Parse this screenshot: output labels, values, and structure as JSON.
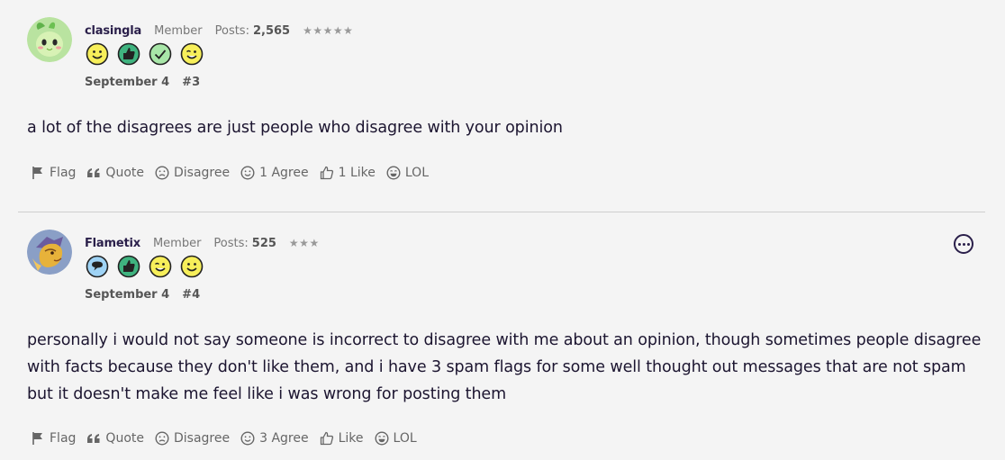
{
  "posts": [
    {
      "username": "clasingla",
      "role": "Member",
      "posts_label": "Posts:",
      "posts_count": "2,565",
      "stars": "★★★★★",
      "date": "September 4",
      "number": "#3",
      "badges": [
        "smile-icon",
        "thumbs-up-icon",
        "checkmark-icon",
        "wink-icon"
      ],
      "content": "a lot of the disagrees are just people who disagree with your opinion",
      "actions": {
        "flag": "Flag",
        "quote": "Quote",
        "disagree": "Disagree",
        "agree": "1 Agree",
        "like": "1 Like",
        "lol": "LOL"
      }
    },
    {
      "username": "Flametix",
      "role": "Member",
      "posts_label": "Posts:",
      "posts_count": "525",
      "stars": "★★★",
      "date": "September 4",
      "number": "#4",
      "badges": [
        "speech-bubble-icon",
        "thumbs-up-icon",
        "wink-icon",
        "smile-icon"
      ],
      "content": "personally i would not say someone is incorrect to disagree with me about an opinion, though sometimes people disagree with facts because they don't like them, and i have 3 spam flags for some well thought out messages that are not spam but it doesn't make me feel like i was wrong for posting them",
      "actions": {
        "flag": "Flag",
        "quote": "Quote",
        "disagree": "Disagree",
        "agree": "3 Agree",
        "like": "Like",
        "lol": "LOL"
      }
    }
  ],
  "colors": {
    "background": "#f4f4f4",
    "username": "#2a1f4a",
    "text": "#1c1530",
    "muted": "#666666",
    "badge_yellow": "#f7ef5a",
    "badge_green": "#3fb37f",
    "badge_check": "#a8e6a8",
    "badge_blue": "#9fd3f5"
  }
}
